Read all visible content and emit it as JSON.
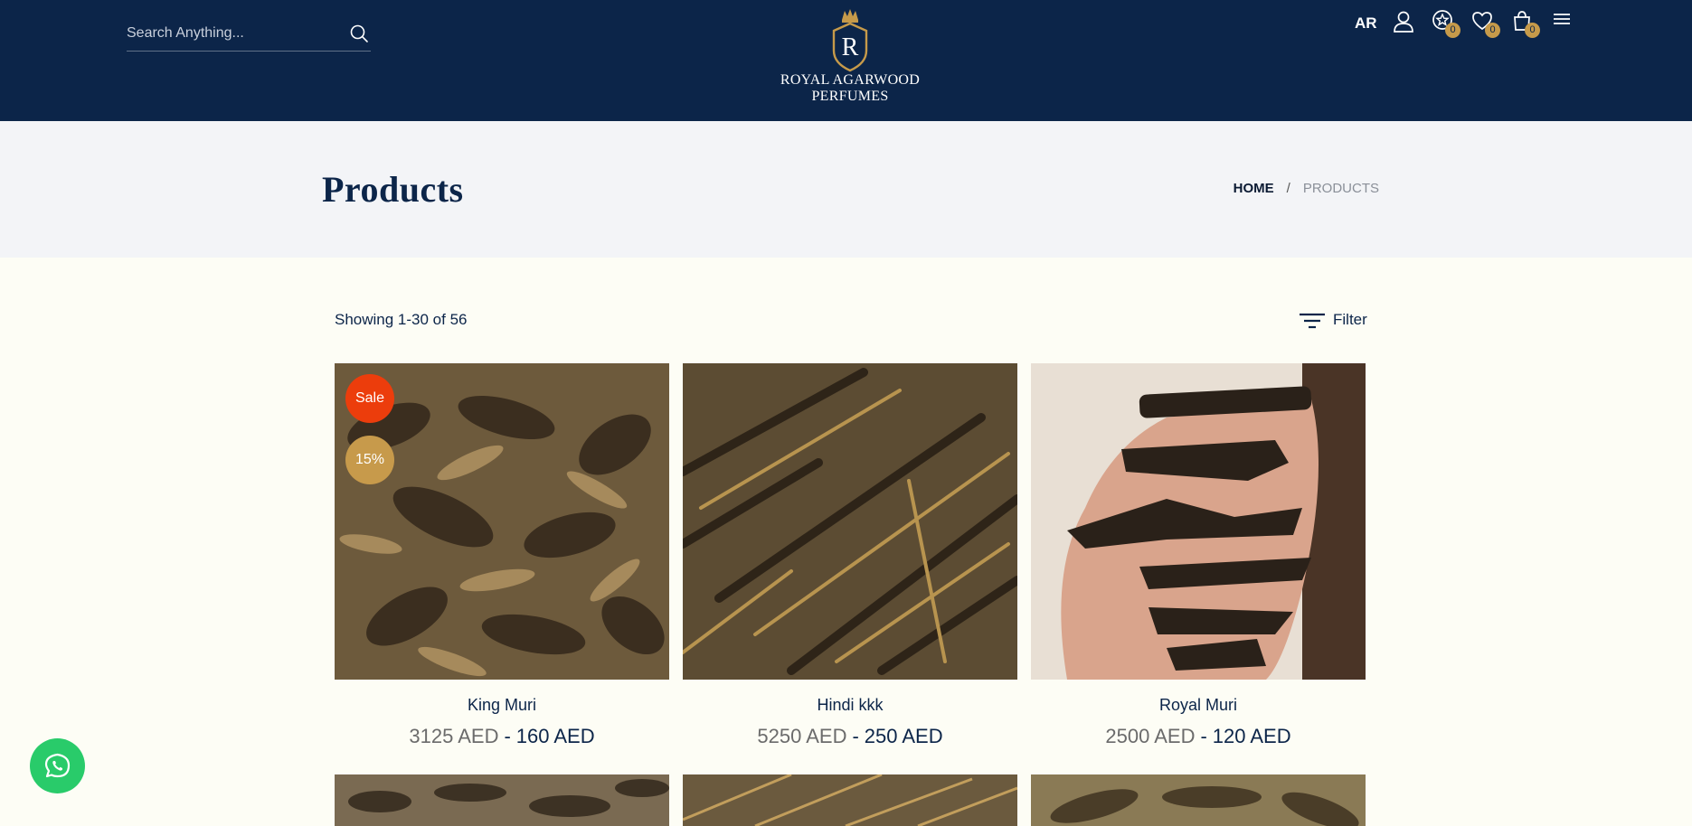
{
  "header": {
    "search_placeholder": "Search Anything...",
    "logo_letter": "R",
    "logo_line1": "ROYAL AGARWOOD",
    "logo_line2": "PERFUMES",
    "lang": "AR",
    "badges": {
      "rewards": "0",
      "wishlist": "0",
      "cart": "0"
    }
  },
  "banner": {
    "title": "Products",
    "breadcrumb": {
      "home": "HOME",
      "separator": "/",
      "current": "PRODUCTS"
    }
  },
  "listing": {
    "showing": "Showing 1-30 of 56",
    "filter_label": "Filter"
  },
  "products": [
    {
      "name": "King Muri",
      "old_price": "3125 AED",
      "dash": "-",
      "new_price": "160 AED",
      "sale": "Sale",
      "discount": "15%"
    },
    {
      "name": "Hindi kkk",
      "old_price": "5250 AED",
      "dash": "-",
      "new_price": "250 AED"
    },
    {
      "name": "Royal Muri",
      "old_price": "2500 AED",
      "dash": "-",
      "new_price": "120 AED"
    }
  ],
  "colors": {
    "header_bg": "#0c2549",
    "accent_gold": "#c69a4a",
    "sale_red": "#ec3d0c",
    "whatsapp_green": "#29cb6a"
  }
}
